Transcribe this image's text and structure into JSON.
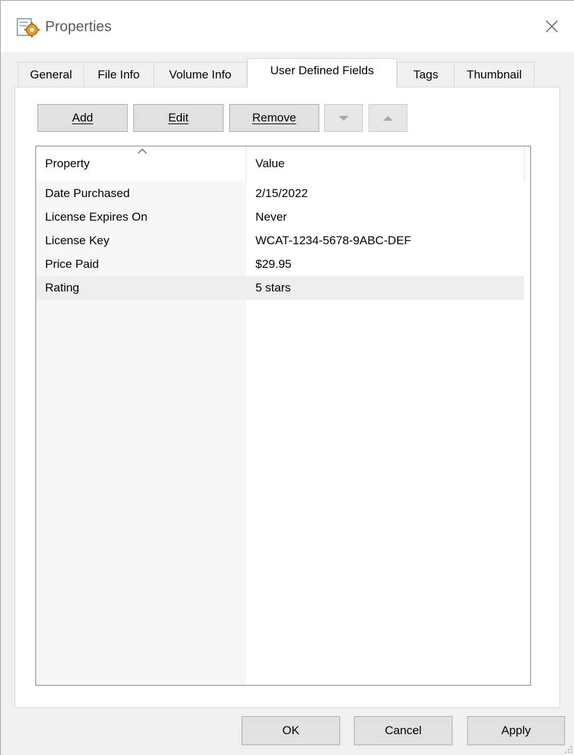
{
  "window": {
    "title": "Properties",
    "app_icon": "properties-gear-icon",
    "close_icon": "close-icon"
  },
  "tabs": [
    {
      "label": "General",
      "active": false
    },
    {
      "label": "File Info",
      "active": false
    },
    {
      "label": "Volume Info",
      "active": false
    },
    {
      "label": "User Defined Fields",
      "active": true
    },
    {
      "label": "Tags",
      "active": false
    },
    {
      "label": "Thumbnail",
      "active": false
    }
  ],
  "toolbar": {
    "add_label": "Add",
    "edit_label": "Edit",
    "remove_label": "Remove",
    "move_down_icon": "arrow-down-icon",
    "move_up_icon": "arrow-up-icon"
  },
  "list": {
    "columns": [
      "Property",
      "Value"
    ],
    "sort_icon": "sort-ascending-icon",
    "rows": [
      {
        "property": "Date Purchased",
        "value": "2/15/2022",
        "selected": false
      },
      {
        "property": "License Expires On",
        "value": "Never",
        "selected": false
      },
      {
        "property": "License Key",
        "value": "WCAT-1234-5678-9ABC-DEF",
        "selected": false
      },
      {
        "property": "Price Paid",
        "value": "$29.95",
        "selected": false
      },
      {
        "property": "Rating",
        "value": "5 stars",
        "selected": true
      }
    ]
  },
  "buttons": {
    "ok_label": "OK",
    "cancel_label": "Cancel",
    "apply_label": "Apply"
  },
  "colors": {
    "dialog_bg": "#f0f0f0",
    "button_bg": "#e1e1e1",
    "selection_bg": "#eeeeee"
  }
}
